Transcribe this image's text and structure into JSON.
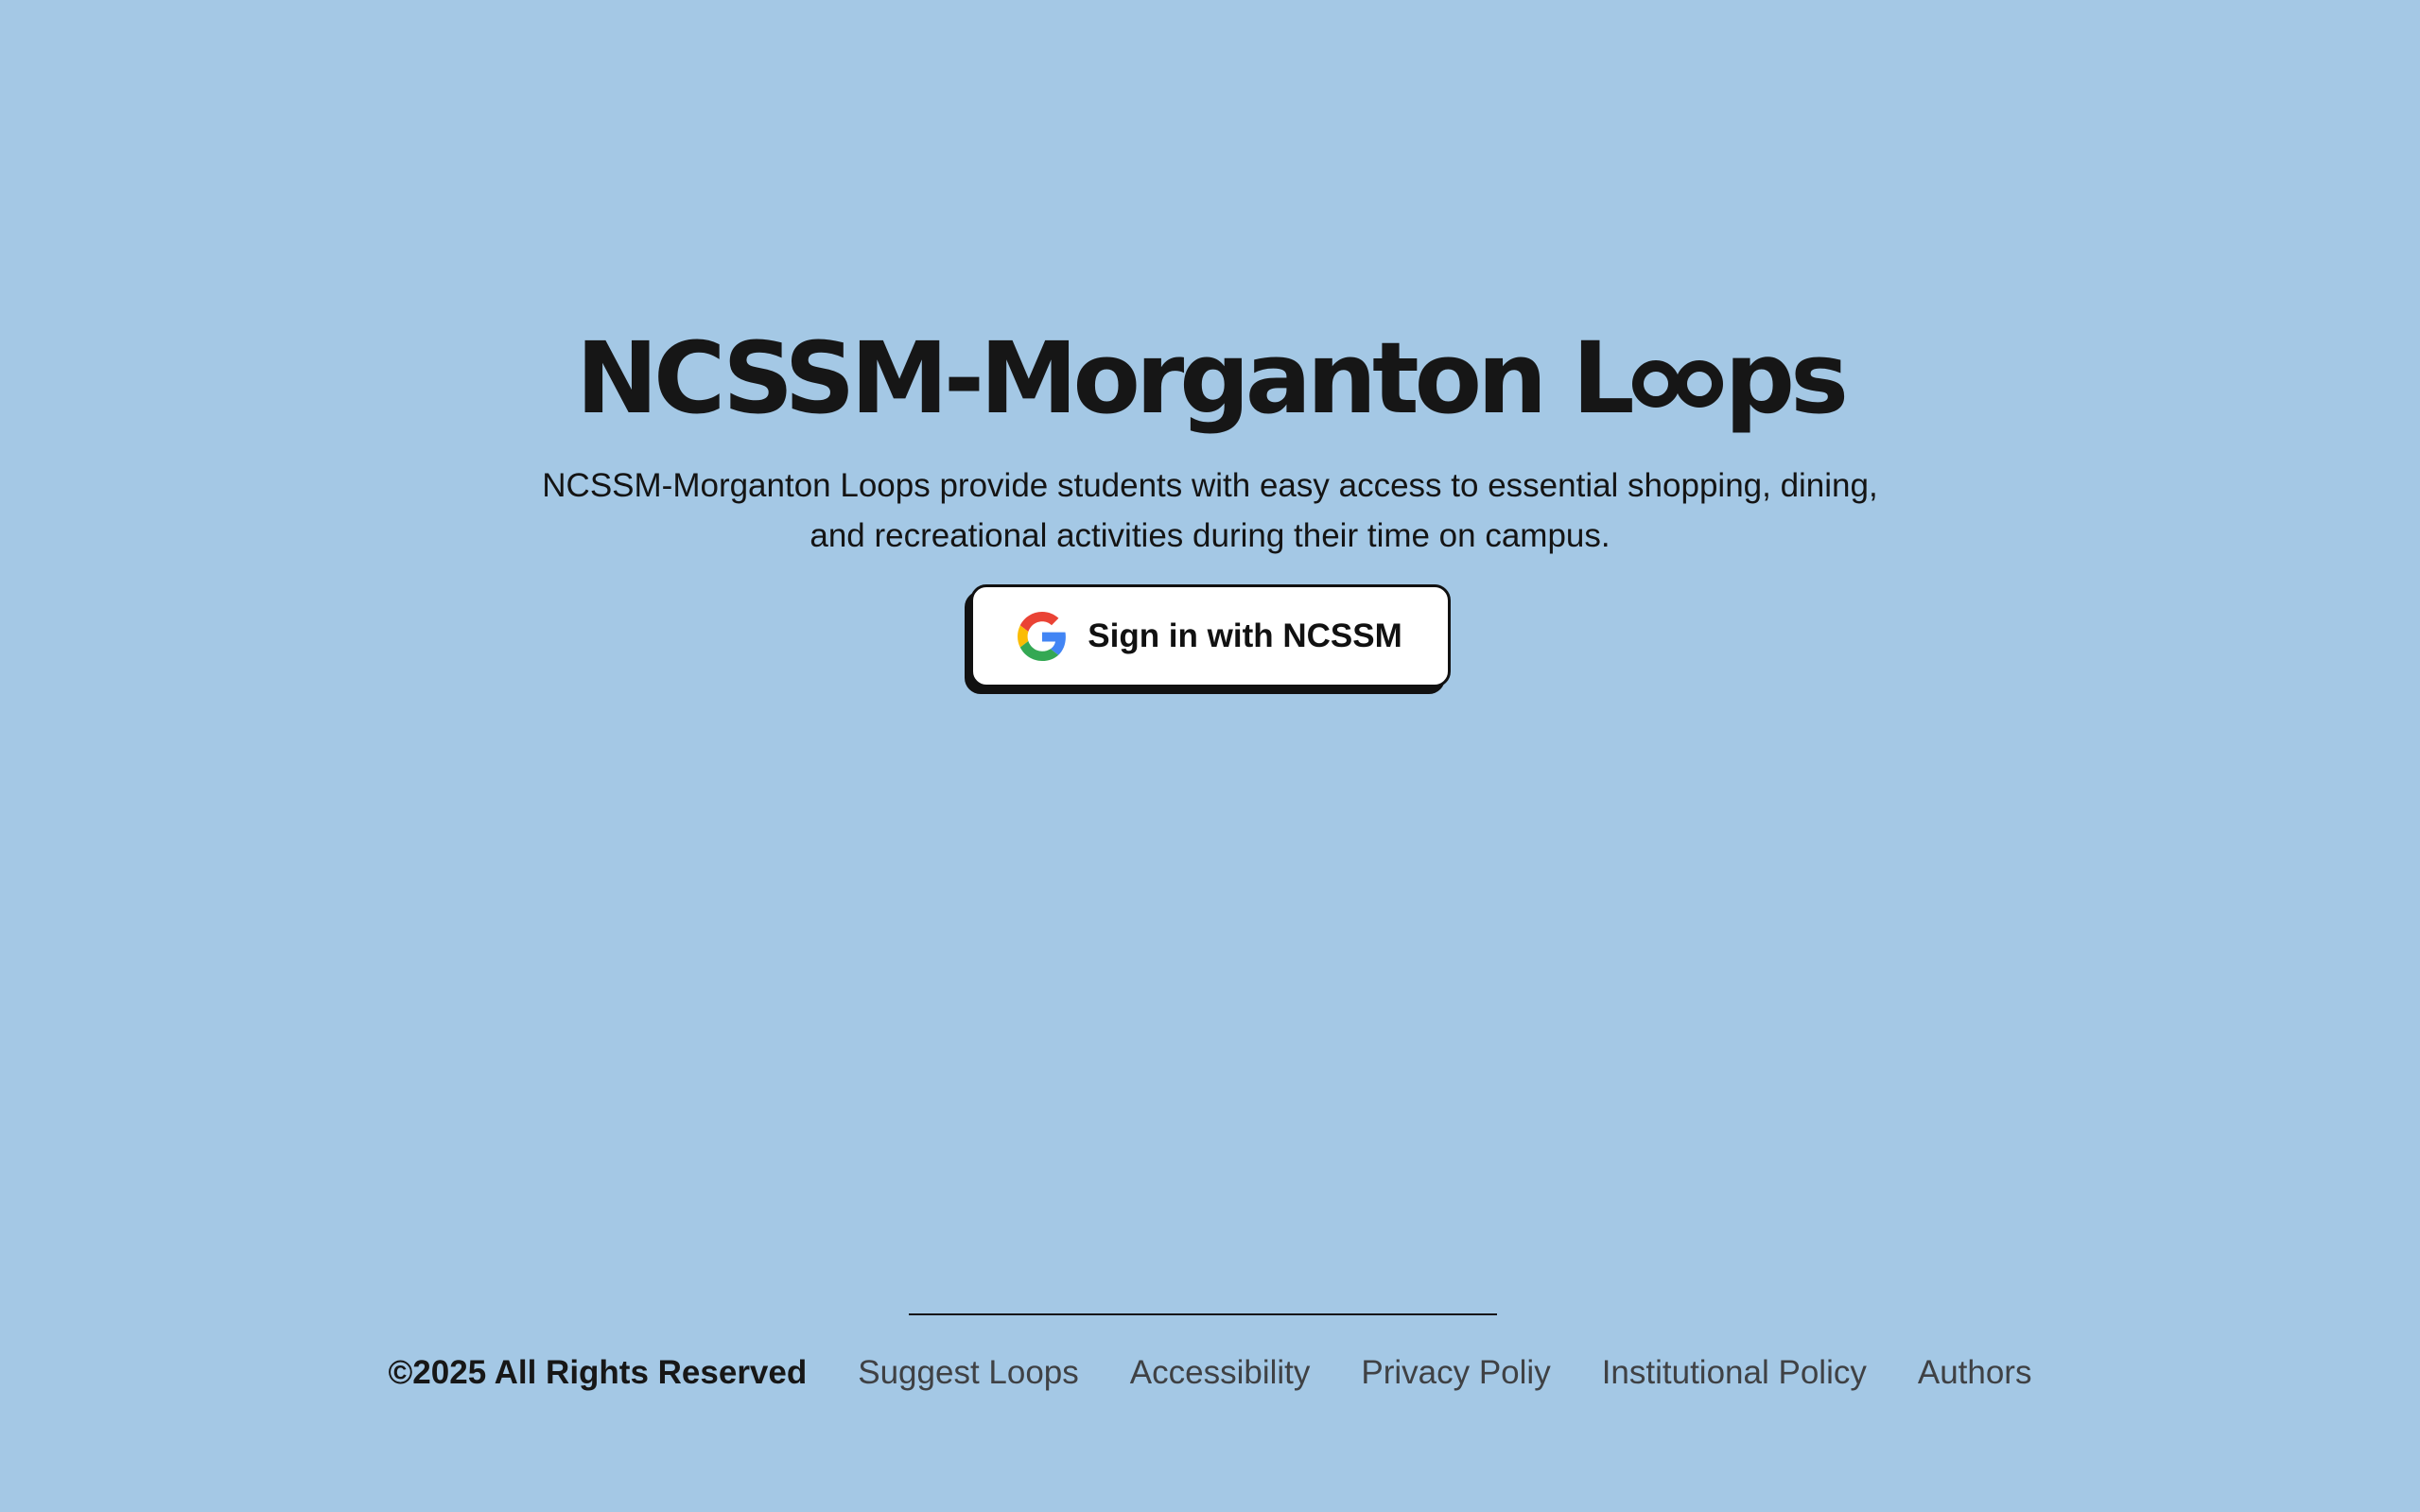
{
  "hero": {
    "title_prefix": "NCSSM-Morganton L",
    "title_suffix": "ps",
    "description": "NCSSM-Morganton Loops provide students with easy access to essential shopping, dining, and recreational activities during their time on campus."
  },
  "signin": {
    "label": "Sign in with NCSSM",
    "icon": "google-icon"
  },
  "footer": {
    "copyright": "©2025 All Rights Reserved",
    "links": [
      {
        "label": "Suggest Loops"
      },
      {
        "label": "Accessibility"
      },
      {
        "label": "Privacy Poliy"
      },
      {
        "label": "Institutional Policy"
      },
      {
        "label": "Authors"
      }
    ]
  },
  "colors": {
    "background": "#a4c8e5",
    "text": "#141414",
    "link": "#3f4144",
    "button_bg": "#ffffff",
    "google_blue": "#4285F4",
    "google_red": "#EA4335",
    "google_yellow": "#FBBC05",
    "google_green": "#34A853"
  }
}
